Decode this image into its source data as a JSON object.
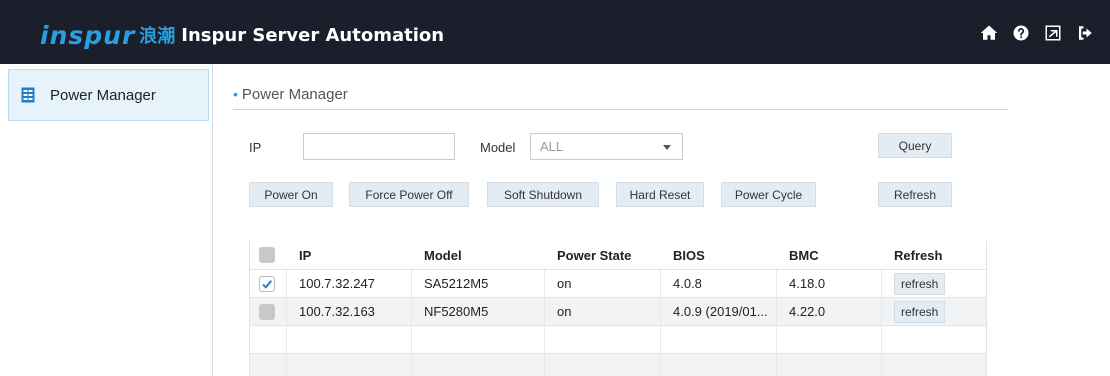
{
  "header": {
    "logo_mark": "inspur",
    "logo_cn": "浪潮",
    "title": "Inspur Server Automation",
    "icons": [
      "home-icon",
      "help-icon",
      "export-icon",
      "logout-icon"
    ]
  },
  "sidebar": {
    "items": [
      {
        "label": "Power Manager",
        "icon": "table-icon"
      }
    ]
  },
  "section": {
    "title": "Power Manager"
  },
  "filters": {
    "ip_label": "IP",
    "ip_value": "",
    "model_label": "Model",
    "model_selected": "ALL",
    "query_label": "Query"
  },
  "actions": {
    "power_on": "Power On",
    "force_power_off": "Force Power Off",
    "soft_shutdown": "Soft Shutdown",
    "hard_reset": "Hard Reset",
    "power_cycle": "Power Cycle",
    "refresh": "Refresh"
  },
  "table": {
    "columns": [
      "IP",
      "Model",
      "Power State",
      "BIOS",
      "BMC",
      "Refresh"
    ],
    "rows": [
      {
        "checked": true,
        "ip": "100.7.32.247",
        "model": "SA5212M5",
        "power_state": "on",
        "bios": "4.0.8",
        "bmc": "4.18.0",
        "refresh": "refresh"
      },
      {
        "checked": false,
        "ip": "100.7.32.163",
        "model": "NF5280M5",
        "power_state": "on",
        "bios": "4.0.9 (2019/01...",
        "bmc": "4.22.0",
        "refresh": "refresh"
      }
    ]
  },
  "colors": {
    "accent": "#2a9fe0",
    "topbar": "#1b1f2b",
    "button_bg": "#e3ecf3"
  }
}
